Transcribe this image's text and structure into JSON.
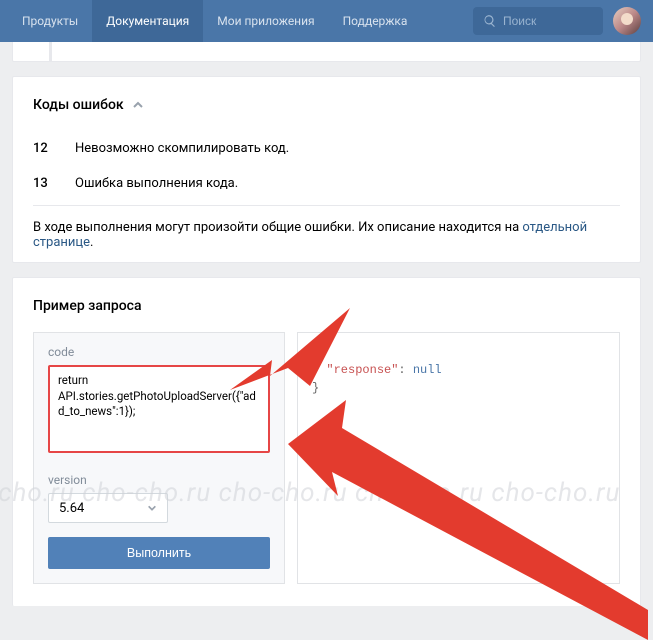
{
  "nav": {
    "items": [
      {
        "label": "Продукты"
      },
      {
        "label": "Документация"
      },
      {
        "label": "Мои приложения"
      },
      {
        "label": "Поддержка"
      }
    ],
    "active_index": 1,
    "search_placeholder": "Поиск"
  },
  "errors_block": {
    "title": "Коды ошибок",
    "rows": [
      {
        "code": "12",
        "desc": "Невозможно скомпилировать код."
      },
      {
        "code": "13",
        "desc": "Ошибка выполнения кода."
      }
    ],
    "note_prefix": "В ходе выполнения могут произойти общие ошибки. Их описание находится на ",
    "note_link": "отдельной странице",
    "note_suffix": "."
  },
  "example_block": {
    "title": "Пример запроса",
    "code_label": "code",
    "code_value": "return API.stories.getPhotoUploadServer({\"add_to_news\":1});",
    "version_label": "version",
    "version_value": "5.64",
    "run_label": "Выполнить",
    "response_key": "\"response\"",
    "response_value": "null"
  },
  "watermark": "ho-cho.ru cho-cho.ru cho-cho.ru cho-cho.ru cho-cho.ru"
}
